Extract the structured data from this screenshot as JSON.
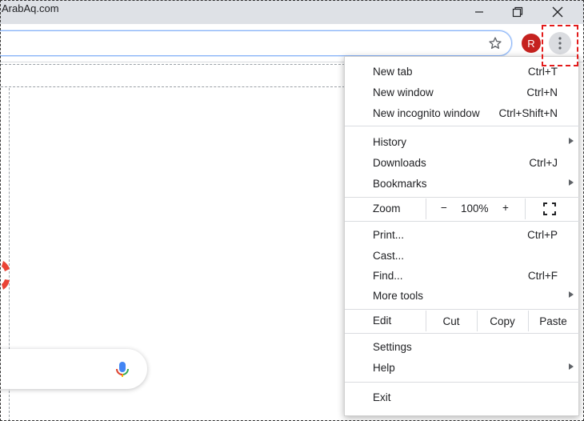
{
  "watermark": "ArabAq.com",
  "toolbar": {
    "avatar_initial": "R"
  },
  "menu": {
    "new_tab": {
      "label": "New tab",
      "shortcut": "Ctrl+T"
    },
    "new_window": {
      "label": "New window",
      "shortcut": "Ctrl+N"
    },
    "new_incognito": {
      "label": "New incognito window",
      "shortcut": "Ctrl+Shift+N"
    },
    "history": {
      "label": "History"
    },
    "downloads": {
      "label": "Downloads",
      "shortcut": "Ctrl+J"
    },
    "bookmarks": {
      "label": "Bookmarks"
    },
    "zoom": {
      "label": "Zoom",
      "minus": "−",
      "value": "100%",
      "plus": "+"
    },
    "print": {
      "label": "Print...",
      "shortcut": "Ctrl+P"
    },
    "cast": {
      "label": "Cast..."
    },
    "find": {
      "label": "Find...",
      "shortcut": "Ctrl+F"
    },
    "more_tools": {
      "label": "More tools"
    },
    "edit": {
      "label": "Edit",
      "cut": "Cut",
      "copy": "Copy",
      "paste": "Paste"
    },
    "settings": {
      "label": "Settings"
    },
    "help": {
      "label": "Help"
    },
    "exit": {
      "label": "Exit"
    }
  },
  "colors": {
    "avatar": "#c5221f",
    "highlight": "#e31b1b",
    "titlebar": "#dee1e6"
  }
}
